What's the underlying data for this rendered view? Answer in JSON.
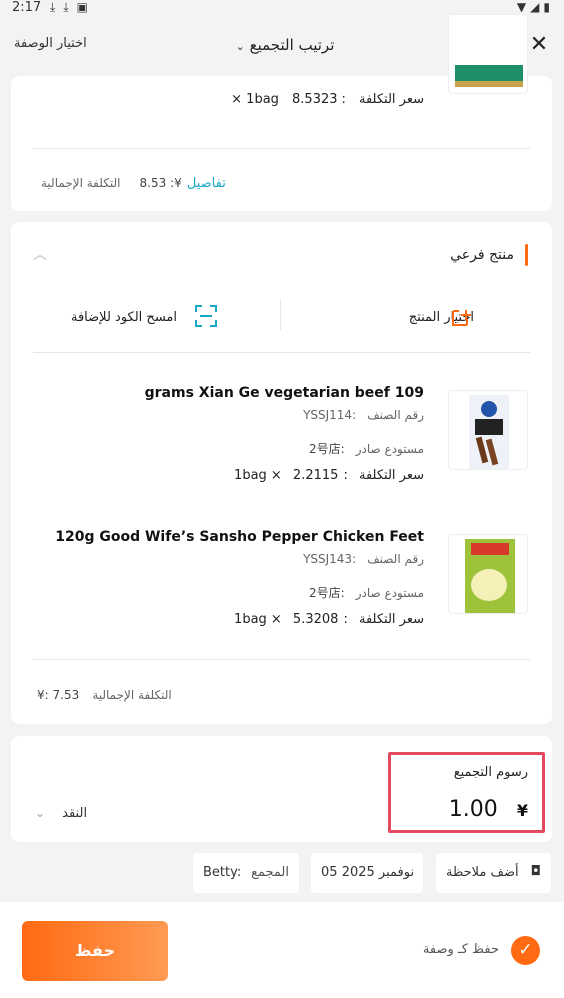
{
  "status_bar": {
    "time": "2:17",
    "left_icons": [
      "download-icon",
      "download-icon",
      "a-icon"
    ],
    "right_icons": [
      "wifi-icon",
      "signal-icon",
      "battery-icon"
    ]
  },
  "header": {
    "title": "ترتيب التجميع",
    "recipe_label": "اختيار الوصفة"
  },
  "top_item": {
    "cost_label": "سعر التكلفة",
    "cost_value": "8.5323",
    "qty": "1bag ×"
  },
  "card1_total": {
    "label": "التكلفة الإجمالية",
    "value": "¥: 8.53",
    "details": "تفاصيل"
  },
  "subproduct": {
    "title": "منتج فرعي",
    "select_product": "اختيار المنتج",
    "scan_code": "امسح الكود للإضافة",
    "items": [
      {
        "name": "grams Xian Ge vegetarian beef 109",
        "sku_label": "رقم الصنف",
        "sku": "YSSJ114:",
        "warehouse_label": "مستودع صادر",
        "warehouse": "2号店:",
        "cost_label": "سعر التكلفة",
        "cost_value": "2.2115",
        "qty": "1bag ×"
      },
      {
        "name": "120g Good Wife’s Sansho Pepper Chicken Feet",
        "sku_label": "رقم الصنف",
        "sku": "YSSJ143:",
        "warehouse_label": "مستودع صادر",
        "warehouse": "2号店:",
        "cost_label": "سعر التكلفة",
        "cost_value": "5.3208",
        "qty": "1bag ×"
      }
    ],
    "total_label": "التكلفة الإجمالية",
    "total_value": "¥: 7.53"
  },
  "fees": {
    "label": "رسوم التجميع",
    "value": "1.00",
    "currency": "¥",
    "payment_label": "النقد"
  },
  "chips": {
    "note": "أضف ملاحظة",
    "date": "05 نوفمبر 2025",
    "assembler_label": "المجمع",
    "assembler_value": "Betty:"
  },
  "bottom": {
    "save": "حفظ",
    "save_as_recipe": "حفظ كـ وصفة"
  },
  "colors": {
    "accent": "#ff6a13",
    "link": "#17a8c8",
    "highlight_border": "#e34a5e"
  }
}
